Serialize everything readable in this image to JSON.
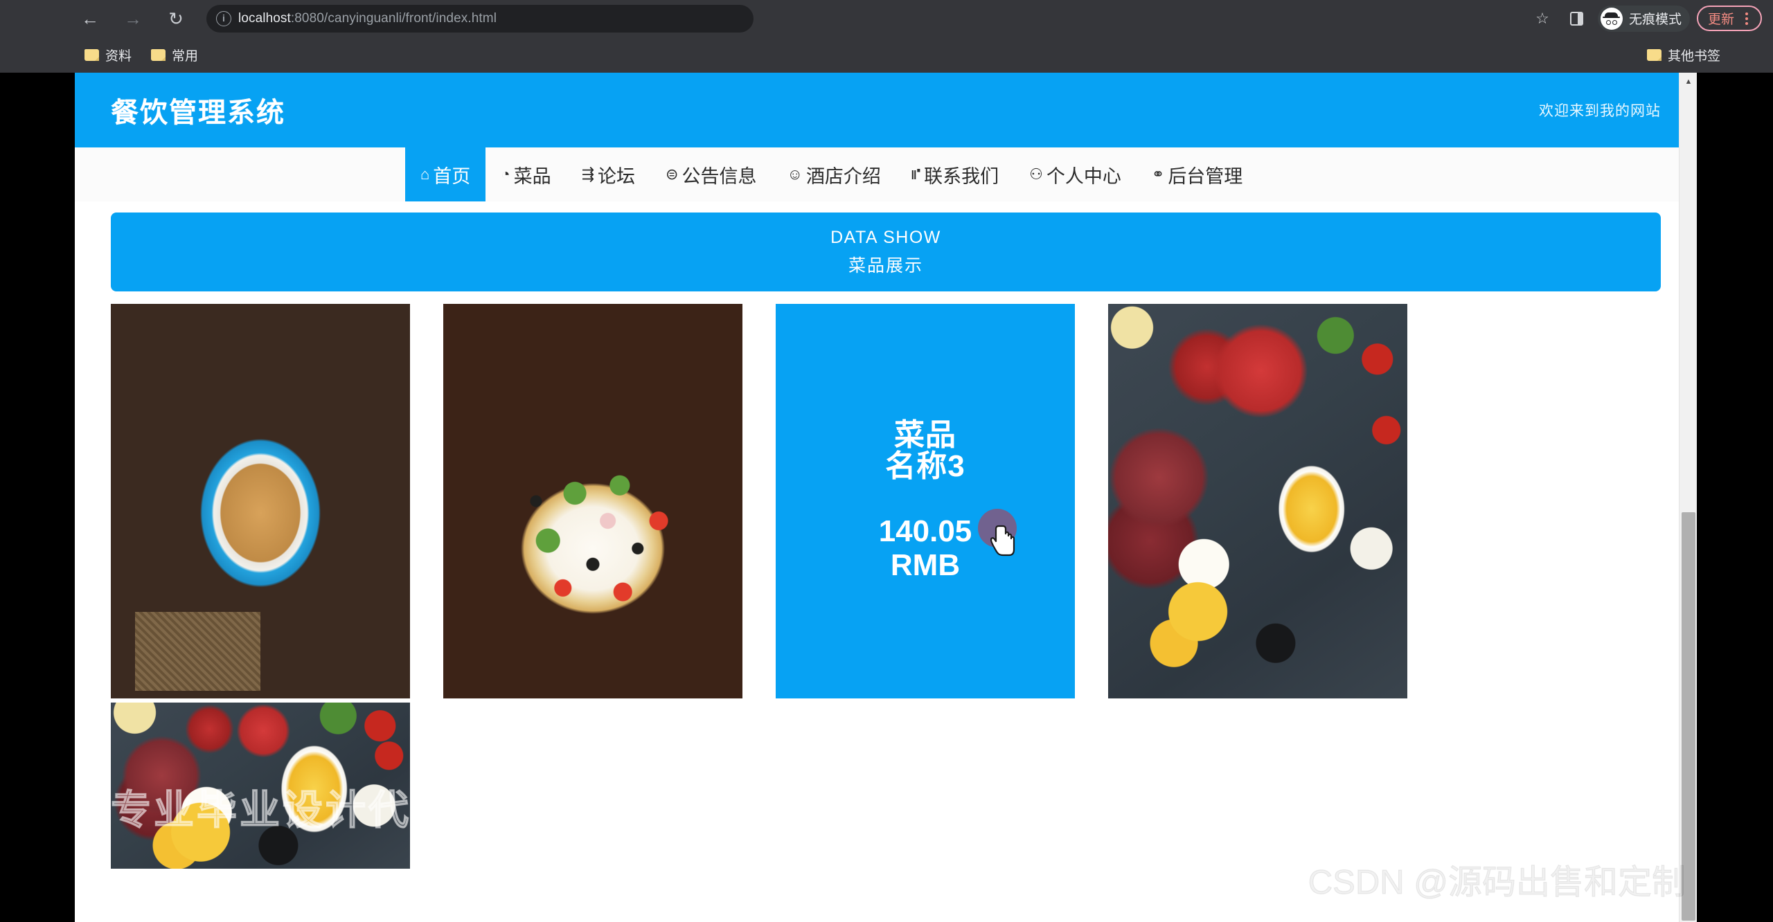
{
  "browser": {
    "back_icon": "back-arrow-icon",
    "forward_icon": "forward-arrow-icon",
    "reload_icon": "reload-icon",
    "site_info_icon": "info-circle-icon",
    "url_host": "localhost",
    "url_path": ":8080/canyinguanli/front/index.html",
    "url_full": "localhost:8080/canyinguanli/front/index.html",
    "star_icon": "bookmark-star-icon",
    "panel_icon": "side-panel-icon",
    "incognito_label": "无痕模式",
    "update_label": "更新",
    "menu_icon": "three-dot-menu-icon",
    "bookmarks": [
      {
        "label": "资料",
        "icon": "folder-icon"
      },
      {
        "label": "常用",
        "icon": "folder-icon"
      }
    ],
    "other_bookmarks": {
      "label": "其他书签",
      "icon": "folder-icon"
    }
  },
  "site": {
    "title": "餐饮管理系统",
    "welcome": "欢迎来到我的网站",
    "accent_color": "#07a2f3",
    "nav": [
      {
        "label": "首页",
        "icon": "⌂",
        "icon_name": "home-icon",
        "active": true
      },
      {
        "label": "菜品",
        "icon": "◔",
        "icon_name": "dish-icon",
        "active": false
      },
      {
        "label": "论坛",
        "icon": "⇶",
        "icon_name": "forum-icon",
        "active": false
      },
      {
        "label": "公告信息",
        "icon": "⊜",
        "icon_name": "announcement-icon",
        "active": false
      },
      {
        "label": "酒店介绍",
        "icon": "☺",
        "icon_name": "hotel-icon",
        "active": false
      },
      {
        "label": "联系我们",
        "icon": "⑈",
        "icon_name": "contact-icon",
        "active": false
      },
      {
        "label": "个人中心",
        "icon": "⚇",
        "icon_name": "user-icon",
        "active": false
      },
      {
        "label": "后台管理",
        "icon": "⚭",
        "icon_name": "link-icon",
        "active": false
      }
    ],
    "banner": {
      "en": "DATA SHOW",
      "cn": "菜品展示"
    },
    "cards": [
      {
        "kind": "photo",
        "photo": "noodles-in-blue-bowl"
      },
      {
        "kind": "photo",
        "photo": "vegetable-pizza"
      },
      {
        "kind": "hover",
        "dish_name": "菜品名称3",
        "price": "140.05",
        "currency": "RMB"
      },
      {
        "kind": "photo",
        "photo": "charcuterie-cheese-board"
      }
    ],
    "second_row": [
      {
        "kind": "photo",
        "photo": "charcuterie-cheese-board"
      }
    ]
  },
  "watermarks": {
    "design": "专业毕业设计代做",
    "csdn": "CSDN @源码出售和定制"
  },
  "scrollbar": {
    "up_arrow": "▲"
  }
}
